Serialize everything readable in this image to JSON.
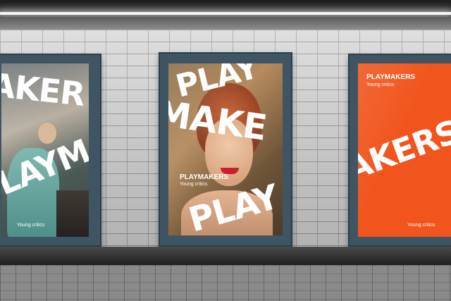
{
  "posters": {
    "left": {
      "big_line_1": "AKER",
      "big_line_2": "LAYM",
      "tagline": "Young critics"
    },
    "center": {
      "big_line_1": "PLAY",
      "big_line_2": "MAKE",
      "big_line_3": "PLAY",
      "brand": "PLAYMAKERS",
      "tagline": "Young critics"
    },
    "right": {
      "brand": "PLAYMAKERS",
      "tagline": "Young critics",
      "big_line_1": "AKERS",
      "tagline_bottom": "Young critics"
    }
  },
  "colors": {
    "frame": "#3f5563",
    "poster_orange": "#f1541c",
    "text": "#ffffff"
  }
}
